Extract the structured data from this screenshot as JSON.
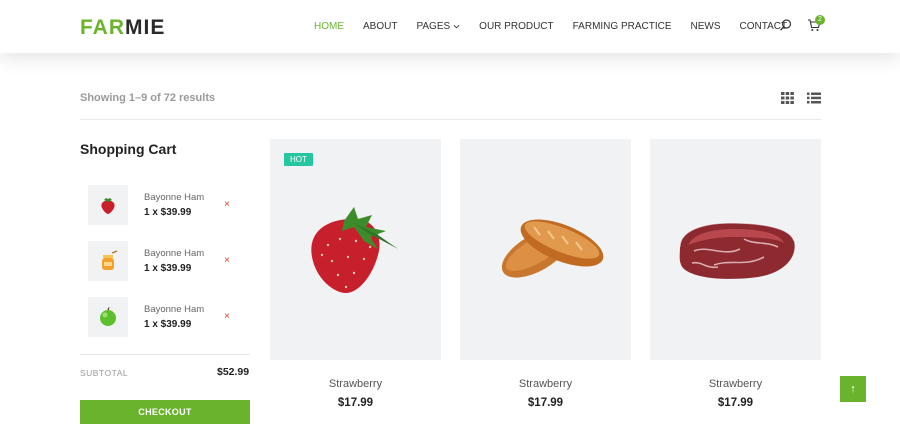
{
  "brand": {
    "part1": "FAR",
    "part2": "MIE",
    "accent_color": "#6ab42d"
  },
  "nav": {
    "items": [
      {
        "label": "HOME",
        "active": true
      },
      {
        "label": "ABOUT",
        "active": false
      },
      {
        "label": "PAGES",
        "active": false,
        "has_dropdown": true
      },
      {
        "label": "OUR PRODUCT",
        "active": false
      },
      {
        "label": "FARMING PRACTICE",
        "active": false
      },
      {
        "label": "NEWS",
        "active": false
      },
      {
        "label": "CONTACT",
        "active": false
      }
    ],
    "icons": [
      "search-icon",
      "cart-icon"
    ],
    "cart_count": "2"
  },
  "toolbar": {
    "results_text": "Showing 1–9 of 72 results",
    "view_icons": [
      "grid-view-icon",
      "list-view-icon"
    ]
  },
  "sidebar": {
    "title": "Shopping Cart",
    "items": [
      {
        "name": "Bayonne Ham",
        "qty_price": "1 x $39.99",
        "remove": "×",
        "thumb_icon": "strawberry-icon"
      },
      {
        "name": "Bayonne Ham",
        "qty_price": "1 x $39.99",
        "remove": "×",
        "thumb_icon": "honey-jar-icon"
      },
      {
        "name": "Bayonne Ham",
        "qty_price": "1 x $39.99",
        "remove": "×",
        "thumb_icon": "green-apple-icon"
      }
    ],
    "subtotal_label": "SUBTOTAL",
    "subtotal_value": "$52.99",
    "checkout_label": "CHECKOUT"
  },
  "products": [
    {
      "name": "Strawberry",
      "price": "$17.99",
      "badge": "HOT",
      "image_icon": "strawberry-image"
    },
    {
      "name": "Strawberry",
      "price": "$17.99",
      "badge": "",
      "image_icon": "bread-image"
    },
    {
      "name": "Strawberry",
      "price": "$17.99",
      "badge": "",
      "image_icon": "raw-meat-image"
    }
  ],
  "scroll_top": {
    "label": "↑"
  },
  "colors": {
    "hot_badge": "#26c6a1",
    "remove": "#e0392b",
    "image_bg": "#f1f2f4"
  }
}
